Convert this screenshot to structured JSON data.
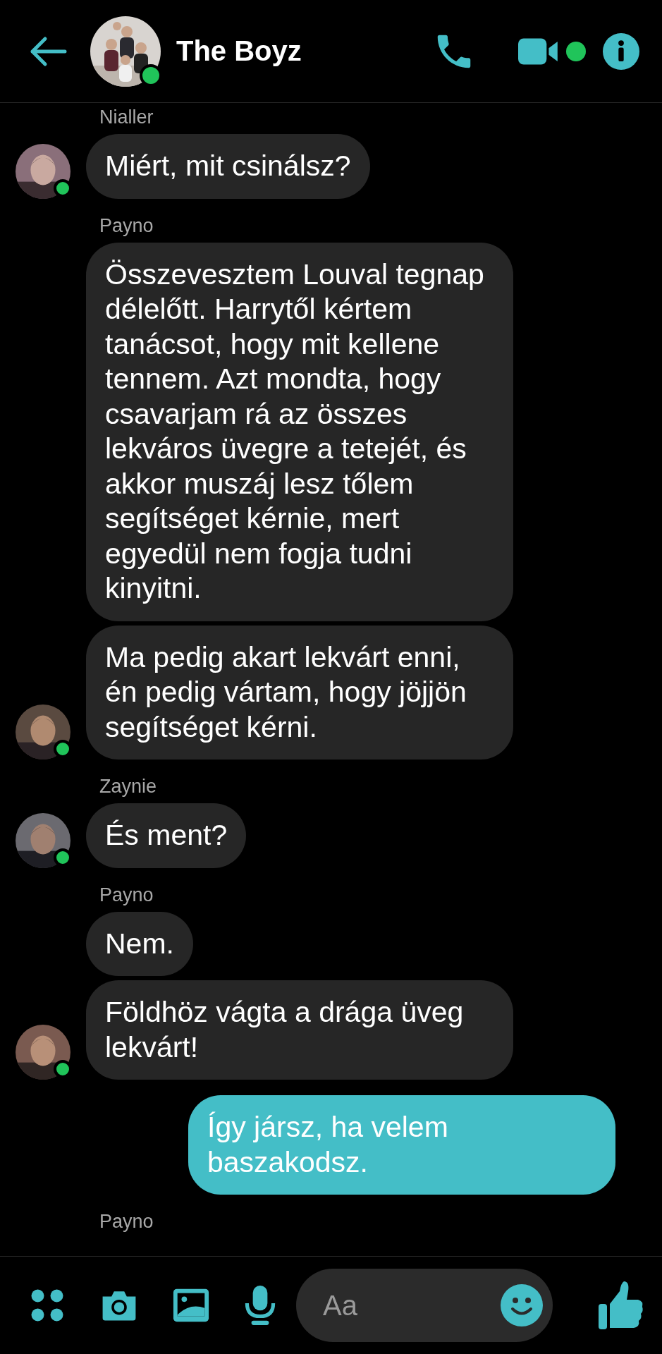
{
  "header": {
    "title": "The Boyz",
    "online": true,
    "video_active": true
  },
  "groups": [
    {
      "kind": "incoming",
      "sender": "Nialler",
      "online": true,
      "messages": [
        "Miért, mit csinálsz?"
      ]
    },
    {
      "kind": "incoming",
      "sender": "Payno",
      "online": true,
      "messages": [
        "Összevesztem Louval tegnap délelőtt. Harrytől kértem tanácsot, hogy mit kellene tennem. Azt mondta, hogy csavarjam rá az összes lekváros üvegre a tetejét, és akkor muszáj lesz tőlem segítséget kérnie, mert egyedül nem fogja tudni kinyitni.",
        "Ma pedig akart lekvárt enni, én pedig vártam, hogy jöjjön segítséget kérni."
      ]
    },
    {
      "kind": "incoming",
      "sender": "Zaynie",
      "online": true,
      "messages": [
        "És ment?"
      ]
    },
    {
      "kind": "incoming",
      "sender": "Payno",
      "online": true,
      "messages": [
        "Nem.",
        "Földhöz vágta a drága üveg lekvárt!"
      ]
    },
    {
      "kind": "outgoing",
      "messages": [
        "Így jársz, ha velem baszakodsz."
      ]
    },
    {
      "kind": "incoming",
      "sender": "Payno"
    }
  ],
  "composer": {
    "placeholder": "Aa"
  }
}
